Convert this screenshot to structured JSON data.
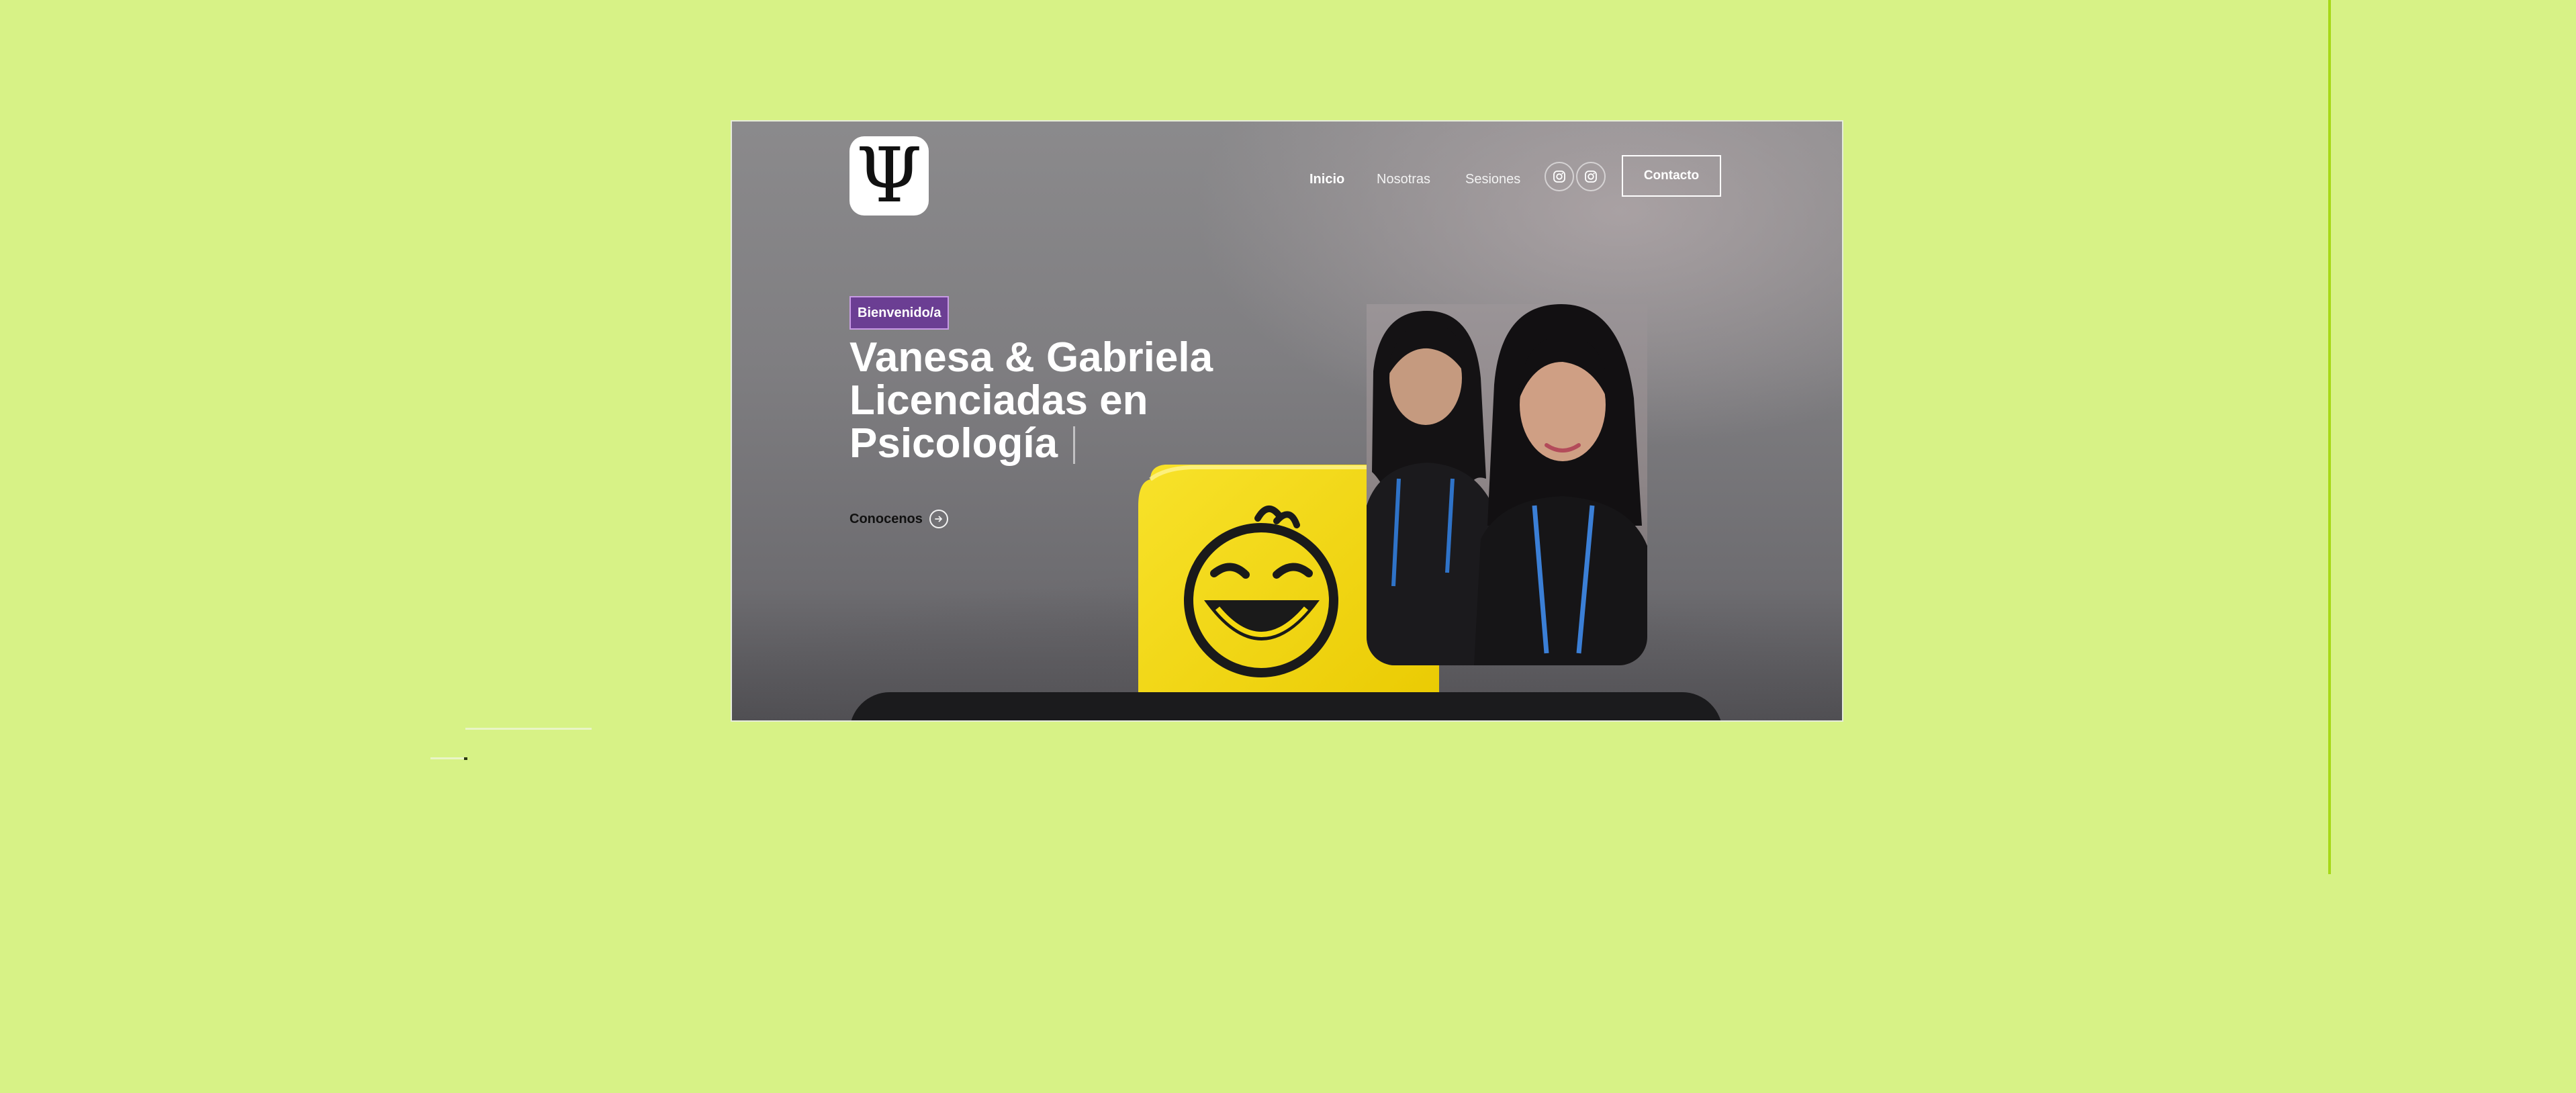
{
  "brand": {
    "logo_symbol": "Ψ"
  },
  "nav": {
    "items": [
      {
        "label": "Inicio",
        "active": true
      },
      {
        "label": "Nosotras",
        "active": false
      },
      {
        "label": "Sesiones",
        "active": false
      }
    ],
    "social": [
      {
        "icon": "instagram-icon"
      },
      {
        "icon": "instagram-icon"
      }
    ],
    "contact_label": "Contacto"
  },
  "hero": {
    "badge": "Bienvenido/a",
    "title_lines": [
      "Vanesa & Gabriela",
      "Licenciadas en",
      "Psicología"
    ],
    "cta_label": "Conocenos",
    "cta_icon": "arrow-right-circle-icon"
  },
  "colors": {
    "page_background": "#d7f286",
    "accent_line": "#a6d916",
    "badge_background": "#6b3e93",
    "dice_yellow": "#f5d90f",
    "bottom_bar": "#1b1b1d"
  }
}
